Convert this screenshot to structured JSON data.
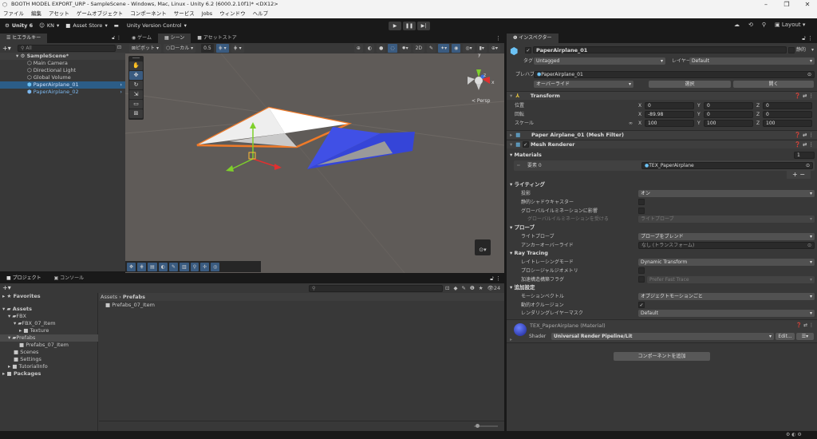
{
  "window": {
    "title": "BOOTH MODEL EXPORT_URP - SampleScene - Windows, Mac, Linux - Unity 6.2 (6000.2.10f1)* <DX12>",
    "minimize": "–",
    "maximize": "❐",
    "close": "✕"
  },
  "menu": [
    "ファイル",
    "編集",
    "アセット",
    "ゲームオブジェクト",
    "コンポーネント",
    "サービス",
    "Jobs",
    "ウィンドウ",
    "ヘルプ"
  ],
  "toolbar": {
    "unity": "Unity 6",
    "account": "KN",
    "asset_store": "Asset Store",
    "version_control": "Unity Version Control",
    "layout": "Layout"
  },
  "hierarchy": {
    "tab": "ヒエラルキー",
    "search_placeholder": "All",
    "scene": "SampleScene*",
    "items": [
      "Main Camera",
      "Directional Light",
      "Global Volume",
      "PaperAirplane_01",
      "PaperAirplane_02"
    ]
  },
  "scene_tabs": [
    "ゲーム",
    "シーン",
    "アセットストア"
  ],
  "scene_toolbar": {
    "pivot": "ピボット",
    "local": "ローカル",
    "snap": "0.5"
  },
  "scene": {
    "persp": "< Persp",
    "axis_y": "y",
    "axis_x": "x",
    "axis_z": "z"
  },
  "inspector": {
    "tab": "インスペクター",
    "object_name": "PaperAirplane_01",
    "static": "静的",
    "tag_label": "タグ",
    "tag": "Untagged",
    "layer_label": "レイヤー",
    "layer": "Default",
    "prefab_label": "プレハブ",
    "prefab": "PaperAirplane_01",
    "overrides": "オーバーライド",
    "select": "選択",
    "open": "開く",
    "transform": {
      "title": "Transform",
      "position_label": "位置",
      "rotation_label": "回転",
      "scale_label": "スケール",
      "position": [
        "0",
        "0",
        "0"
      ],
      "rotation": [
        "-89.98",
        "0",
        "0"
      ],
      "scale": [
        "100",
        "100",
        "100"
      ]
    },
    "mesh_filter": "Paper Airplane_01 (Mesh Filter)",
    "mesh_renderer": "Mesh Renderer",
    "materials": {
      "label": "Materials",
      "count": "1",
      "element_label": "要素 0",
      "element": "TEX_PaperAirplane",
      "plus": "+",
      "minus": "−"
    },
    "lighting": {
      "label": "ライティング",
      "cast_shadows_label": "投影",
      "cast_shadows": "オン",
      "static_shadow_label": "静的シャドウキャスター",
      "gi_label": "グローバルイルミネーションに影響",
      "receive_gi_label": "グローバルイルミネーションを受ける",
      "receive_gi": "ライトプローブ"
    },
    "probes": {
      "label": "プローブ",
      "light_probes_label": "ライトプローブ",
      "light_probes": "プローブをブレンド",
      "anchor_label": "アンカーオーバーライド",
      "anchor": "なし (トランスフォーム)"
    },
    "ray_tracing": {
      "label": "Ray Tracing",
      "mode_label": "レイトレーシングモード",
      "mode": "Dynamic Transform",
      "procedural_label": "プロシージャルジオメトリ",
      "accel_label": "加速構造構築フラグ",
      "accel": "Prefer Fast Trace"
    },
    "additional": {
      "label": "追加設定",
      "motion_label": "モーションベクトル",
      "motion": "オブジェクトモーションごと",
      "occlusion_label": "動的オクルージョン",
      "mask_label": "レンダリングレイヤーマスク",
      "mask": "Default"
    },
    "material": {
      "name": "TEX_PaperAirplane (Material)",
      "shader_label": "Shader",
      "shader": "Universal Render Pipeline/Lit",
      "edit": "Edit..."
    },
    "add_component": "コンポーネントを追加"
  },
  "project": {
    "tabs": [
      "プロジェクト",
      "コンソール"
    ],
    "favorites": "Favorites",
    "tree": [
      "Assets",
      "FBX",
      "FBX_07_Item",
      "Texture",
      "Prefabs",
      "Prefabs_07_Item",
      "Scenes",
      "Settings",
      "TutorialInfo",
      "Packages"
    ],
    "breadcrumb": [
      "Assets",
      "Prefabs"
    ],
    "items": [
      "Prefabs_07_Item"
    ],
    "hidden_count": "24"
  },
  "colors": {
    "selection": "#2c5d87",
    "accent": "#3a5b80",
    "scene_bg": "#5f5b58",
    "plane_blue": "#3f4fe0",
    "outline": "#f07a28"
  }
}
